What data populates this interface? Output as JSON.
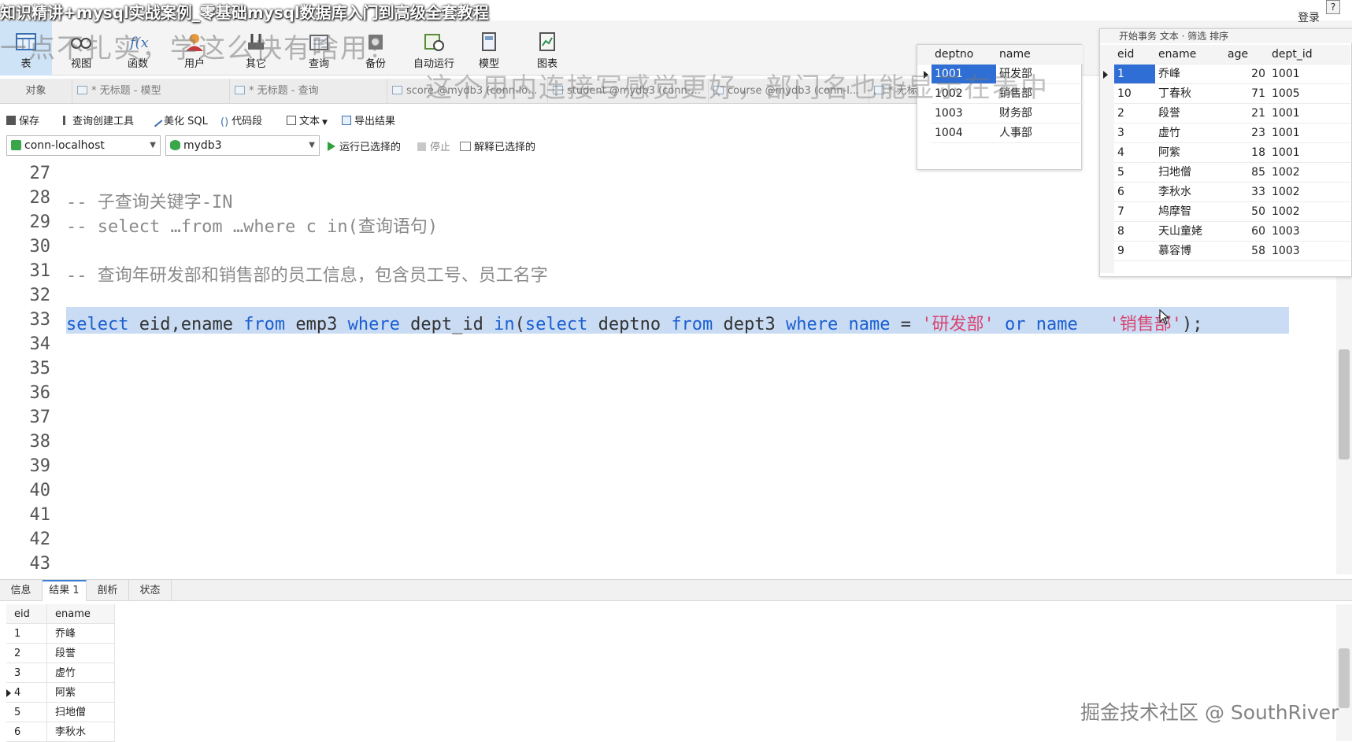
{
  "video_title": "知识精讲+mysql实战案例_零基础mysql数据库入门到高级全套教程",
  "overlay": {
    "line1": "一点不扎实，学这么快有啥用？",
    "line2": "这个用内连接写感觉更好，部门名也能显示在表中"
  },
  "header_right": {
    "login": "登录",
    "help": "?"
  },
  "main_toolbar": {
    "items": [
      {
        "label": "表",
        "icon": "table-icon",
        "active": true
      },
      {
        "label": "视图",
        "icon": "view-icon"
      },
      {
        "label": "函数",
        "icon": "function-icon"
      },
      {
        "label": "用户",
        "icon": "user-icon"
      },
      {
        "label": "其它",
        "icon": "tools-icon"
      },
      {
        "label": "查询",
        "icon": "query-icon"
      },
      {
        "label": "备份",
        "icon": "backup-icon"
      },
      {
        "label": "自动运行",
        "icon": "schedule-icon"
      },
      {
        "label": "模型",
        "icon": "model-icon"
      },
      {
        "label": "图表",
        "icon": "chart-icon"
      }
    ]
  },
  "tabs": [
    {
      "label": "对象"
    },
    {
      "label": "* 无标题 - 模型"
    },
    {
      "label": "* 无标题 - 查询"
    },
    {
      "label": "score @mydb3 (conn-lo..."
    },
    {
      "label": "student @mydb3 (conn-..."
    },
    {
      "label": "course @mydb3 (conn-l..."
    },
    {
      "label": "* 无标"
    }
  ],
  "editor_toolbar": {
    "save": "保存",
    "query_builder": "查询创建工具",
    "beautify": "美化 SQL",
    "snippet": "代码段",
    "text": "文本",
    "export": "导出结果"
  },
  "connection": {
    "connection_value": "conn-localhost",
    "database_value": "mydb3",
    "run_selected": "运行已选择的",
    "stop": "停止",
    "explain_selected": "解释已选择的"
  },
  "editor": {
    "line_numbers": [
      "27",
      "28",
      "29",
      "30",
      "31",
      "32",
      "33",
      "34",
      "35",
      "36",
      "37",
      "38",
      "39",
      "40",
      "41",
      "42",
      "43"
    ],
    "line28": "-- 子查询关键字-IN",
    "line29": "-- select …from …where c in(查询语句)",
    "line31": "-- 查询年研发部和销售部的员工信息，包含员工号、员工名字",
    "line33": {
      "kw_select": "select",
      "t1": " eid,ename ",
      "kw_from": "from",
      "t2": " emp3 ",
      "kw_where": "where",
      "t3": " dept_id ",
      "kw_in": "in",
      "t4": "(",
      "kw_select2": "select",
      "t5": " deptno ",
      "kw_from2": "from",
      "t6": " dept3 ",
      "kw_where2": "where",
      "t7": " ",
      "kw_name": "name",
      "t8": " = ",
      "str1": "'研发部'",
      "t9": " ",
      "kw_or": "or",
      "t10": " ",
      "kw_name2": "name",
      "t11": "   ",
      "str2": "'销售部'",
      "t12": ");"
    }
  },
  "bottom_tabs": [
    {
      "label": "信息"
    },
    {
      "label": "结果 1",
      "active": true
    },
    {
      "label": "剖析"
    },
    {
      "label": "状态"
    }
  ],
  "result_grid": {
    "columns": [
      "eid",
      "ename"
    ],
    "rows": [
      [
        "1",
        "乔峰"
      ],
      [
        "2",
        "段誉"
      ],
      [
        "3",
        "虚竹"
      ],
      [
        "4",
        "阿紫"
      ],
      [
        "5",
        "扫地僧"
      ],
      [
        "6",
        "李秋水"
      ]
    ]
  },
  "dept_panel": {
    "columns": [
      "deptno",
      "name"
    ],
    "rows": [
      [
        "1001",
        "研发部"
      ],
      [
        "1002",
        "销售部"
      ],
      [
        "1003",
        "财务部"
      ],
      [
        "1004",
        "人事部"
      ]
    ]
  },
  "emp_panel": {
    "toolbar": "开始事务   文本 ·  筛选   排序",
    "columns": [
      "eid",
      "ename",
      "age",
      "dept_id"
    ],
    "rows": [
      [
        "1",
        "乔峰",
        "20",
        "1001"
      ],
      [
        "10",
        "丁春秋",
        "71",
        "1005"
      ],
      [
        "2",
        "段誉",
        "21",
        "1001"
      ],
      [
        "3",
        "虚竹",
        "23",
        "1001"
      ],
      [
        "4",
        "阿紫",
        "18",
        "1001"
      ],
      [
        "5",
        "扫地僧",
        "85",
        "1002"
      ],
      [
        "6",
        "李秋水",
        "33",
        "1002"
      ],
      [
        "7",
        "鸠摩智",
        "50",
        "1002"
      ],
      [
        "8",
        "天山童姥",
        "60",
        "1003"
      ],
      [
        "9",
        "慕容博",
        "58",
        "1003"
      ]
    ]
  },
  "site_watermark": "掘金技术社区 @ SouthRiver",
  "colors": {
    "keyword": "#1c5fd0",
    "string": "#d8456f",
    "comment": "#8a8a8a",
    "selection": "#c9dcf4",
    "row_selected": "#2f6fd5"
  }
}
